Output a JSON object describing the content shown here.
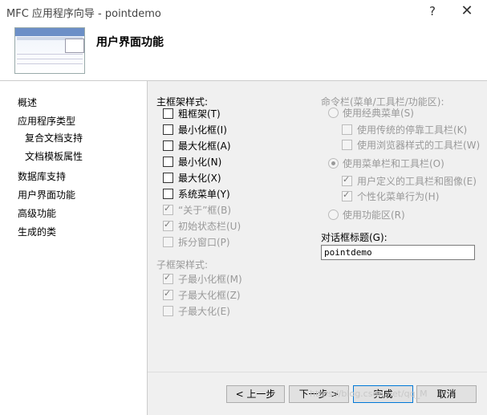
{
  "window": {
    "title": "MFC 应用程序向导 - pointdemo",
    "help_label": "?",
    "close_label": "✕"
  },
  "header": {
    "heading": "用户界面功能"
  },
  "sidebar": {
    "items": [
      {
        "label": "概述"
      },
      {
        "label": "应用程序类型"
      },
      {
        "label": "复合文档支持"
      },
      {
        "label": "文档模板属性"
      },
      {
        "label": "数据库支持"
      },
      {
        "label": "用户界面功能"
      },
      {
        "label": "高级功能"
      },
      {
        "label": "生成的类"
      }
    ]
  },
  "main_frame_styles": {
    "label": "主框架样式:",
    "options": [
      {
        "label": "粗框架(T)",
        "checked": false
      },
      {
        "label": "最小化框(I)",
        "checked": false
      },
      {
        "label": "最大化框(A)",
        "checked": false
      },
      {
        "label": "最小化(N)",
        "checked": false
      },
      {
        "label": "最大化(X)",
        "checked": false
      },
      {
        "label": "系统菜单(Y)",
        "checked": false
      },
      {
        "label": "“关于”框(B)",
        "checked": true
      },
      {
        "label": "初始状态栏(U)",
        "checked": true
      },
      {
        "label": "拆分窗口(P)",
        "checked": false
      }
    ]
  },
  "child_frame_styles": {
    "label": "子框架样式:",
    "options": [
      {
        "label": "子最小化框(M)",
        "checked": true
      },
      {
        "label": "子最大化框(Z)",
        "checked": true
      },
      {
        "label": "子最大化(E)",
        "checked": false
      }
    ]
  },
  "command_bars": {
    "label": "命令栏(菜单/工具栏/功能区):",
    "classic_menu": "使用经典菜单(S)",
    "classic_sub": [
      {
        "label": "使用传统的停靠工具栏(K)",
        "checked": false
      },
      {
        "label": "使用浏览器样式的工具栏(W)",
        "checked": false
      }
    ],
    "menu_toolbar": "使用菜单栏和工具栏(O)",
    "menu_sub": [
      {
        "label": "用户定义的工具栏和图像(E)",
        "checked": true
      },
      {
        "label": "个性化菜单行为(H)",
        "checked": true
      }
    ],
    "ribbon": "使用功能区(R)"
  },
  "dialog_title": {
    "label": "对话框标题(G):",
    "value": "pointdemo"
  },
  "buttons": {
    "back": "< 上一步",
    "next": "下一步 >",
    "finish": "完成",
    "cancel": "取消"
  },
  "watermark": "https://blog.csdn.net/qq_M"
}
